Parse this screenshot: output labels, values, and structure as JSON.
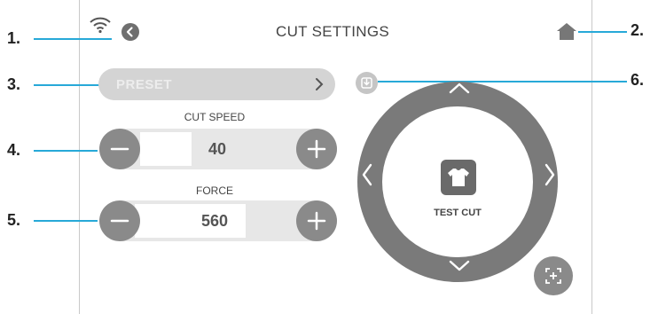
{
  "screen": {
    "title": "CUT SETTINGS"
  },
  "preset": {
    "label": "PRESET"
  },
  "cut_speed": {
    "label": "CUT SPEED",
    "value": "40"
  },
  "force": {
    "label": "FORCE",
    "value": "560"
  },
  "test_cut": {
    "label": "TEST CUT"
  },
  "callouts": [
    "1.",
    "2.",
    "3.",
    "4.",
    "5.",
    "6."
  ],
  "icons": {
    "wifi": "wifi-icon",
    "back": "back-icon",
    "home": "home-icon",
    "save": "save-preset-icon",
    "shirt": "t-shirt-icon",
    "crosshair": "position-crosshair-icon",
    "up": "arrow-up-icon",
    "down": "arrow-down-icon",
    "left": "arrow-left-icon",
    "right": "arrow-right-icon",
    "minus": "minus-icon",
    "plus": "plus-icon",
    "chevron": "chevron-right-icon"
  },
  "colors": {
    "callout_line": "#27a9d8",
    "button_gray": "#8a8a8a",
    "ring_gray": "#7a7a7a",
    "track_gray": "#e7e7e7",
    "preset_gray": "#d4d4d4"
  }
}
